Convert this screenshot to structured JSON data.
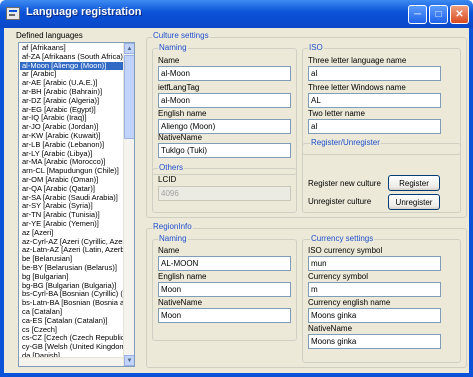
{
  "window": {
    "title": "Language registration"
  },
  "defined_languages": {
    "title": "Defined languages",
    "items": [
      "af [Afrikaans]",
      "af-ZA [Afrikaans (South Africa)]",
      "al-Moon [Aliengo (Moon)]",
      "ar [Arabic]",
      "ar-AE [Arabic (U.A.E.)]",
      "ar-BH [Arabic (Bahrain)]",
      "ar-DZ [Arabic (Algeria)]",
      "ar-EG [Arabic (Egypt)]",
      "ar-IQ [Arabic (Iraq)]",
      "ar-JO [Arabic (Jordan)]",
      "ar-KW [Arabic (Kuwait)]",
      "ar-LB [Arabic (Lebanon)]",
      "ar-LY [Arabic (Libya)]",
      "ar-MA [Arabic (Morocco)]",
      "arn-CL [Mapudungun (Chile)]",
      "ar-OM [Arabic (Oman)]",
      "ar-QA [Arabic (Qatar)]",
      "ar-SA [Arabic (Saudi Arabia)]",
      "ar-SY [Arabic (Syria)]",
      "ar-TN [Arabic (Tunisia)]",
      "ar-YE [Arabic (Yemen)]",
      "az [Azeri]",
      "az-Cyrl-AZ [Azeri (Cyrillic, Azerba",
      "az-Latn-AZ [Azeri (Latin, Azerbai",
      "be [Belarusian]",
      "be-BY [Belarusian (Belarus)]",
      "bg [Bulgarian]",
      "bg-BG [Bulgarian (Bulgaria)]",
      "bs-Cyrl-BA [Bosnian (Cyrillic) (Bo",
      "bs-Latn-BA [Bosnian (Bosnia an",
      "ca [Catalan]",
      "ca-ES [Catalan (Catalan)]",
      "cs [Czech]",
      "cs-CZ [Czech (Czech Republic)",
      "cy-GB [Welsh (United Kingdom",
      "da [Danish]"
    ],
    "selected_index": 2
  },
  "culture_settings": {
    "title": "Culture settings",
    "naming": {
      "title": "Naming",
      "name_label": "Name",
      "name_value": "al-Moon",
      "ietf_label": "ietfLangTag",
      "ietf_value": "al-Moon",
      "english_label": "English name",
      "english_value": "Aliengo (Moon)",
      "native_label": "NativeName",
      "native_value": "Tuklgo (Tuki)"
    },
    "iso": {
      "title": "ISO",
      "two_letter_label": "Three letter language name",
      "two_letter_value": "al",
      "three_win_label": "Three letter Windows name",
      "three_win_value": "AL",
      "two_name_label": "Two letter name",
      "two_name_value": "al"
    },
    "others": {
      "title": "Others",
      "lcid_label": "LCID",
      "lcid_value": "4096"
    },
    "register": {
      "title": "Register/Unregister",
      "register_label": "Register new culture",
      "register_button": "Register",
      "unregister_label": "Unregister culture",
      "unregister_button": "Unregister"
    }
  },
  "region_info": {
    "title": "RegionInfo",
    "naming": {
      "title": "Naming",
      "name_label": "Name",
      "name_value": "AL-MOON",
      "english_label": "English name",
      "english_value": "Moon",
      "native_label": "NativeName",
      "native_value": "Moon"
    },
    "currency": {
      "title": "Currency settings",
      "iso_label": "ISO currency symbol",
      "iso_value": "mun",
      "symbol_label": "Currency symbol",
      "symbol_value": "m",
      "english_label": "Currency english name",
      "english_value": "Moons ginka",
      "native_label": "NativeName",
      "native_value": "Moons ginka"
    }
  }
}
